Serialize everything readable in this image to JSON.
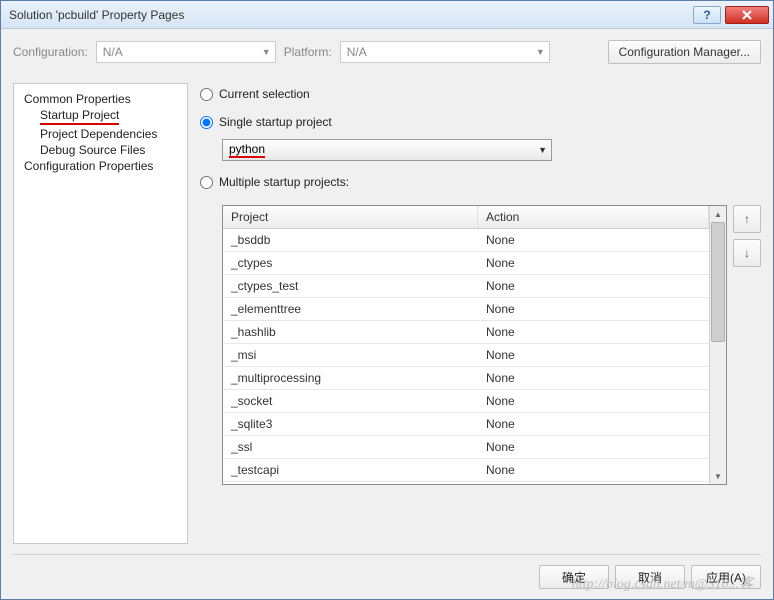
{
  "window": {
    "title": "Solution 'pcbuild' Property Pages"
  },
  "toolbar": {
    "config_label": "Configuration:",
    "config_value": "N/A",
    "platform_label": "Platform:",
    "platform_value": "N/A",
    "config_mgr": "Configuration Manager..."
  },
  "tree": {
    "root1": "Common Properties",
    "n1": "Startup Project",
    "n2": "Project Dependencies",
    "n3": "Debug Source Files",
    "root2": "Configuration Properties"
  },
  "radios": {
    "current": "Current selection",
    "single": "Single startup project",
    "multiple": "Multiple startup projects:"
  },
  "combo": {
    "value": "python"
  },
  "grid": {
    "col_project": "Project",
    "col_action": "Action",
    "rows": [
      {
        "project": "_bsddb",
        "action": "None"
      },
      {
        "project": "_ctypes",
        "action": "None"
      },
      {
        "project": "_ctypes_test",
        "action": "None"
      },
      {
        "project": "_elementtree",
        "action": "None"
      },
      {
        "project": "_hashlib",
        "action": "None"
      },
      {
        "project": "_msi",
        "action": "None"
      },
      {
        "project": "_multiprocessing",
        "action": "None"
      },
      {
        "project": "_socket",
        "action": "None"
      },
      {
        "project": "_sqlite3",
        "action": "None"
      },
      {
        "project": "_ssl",
        "action": "None"
      },
      {
        "project": "_testcapi",
        "action": "None"
      }
    ]
  },
  "footer": {
    "ok": "确定",
    "cancel": "取消",
    "apply": "应用(A)"
  },
  "watermark": "http://blog.csdn.net/m@510...客"
}
